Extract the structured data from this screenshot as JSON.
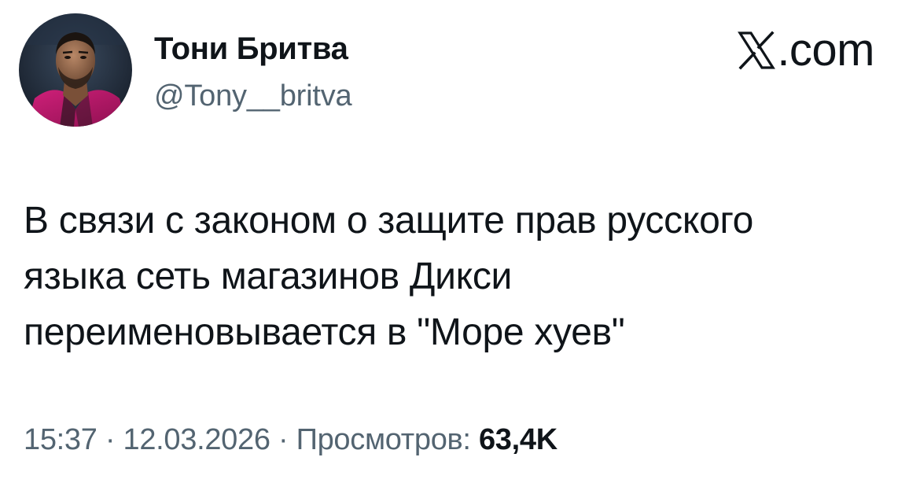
{
  "user": {
    "display_name": "Тони Бритва",
    "handle": "@Tony__britva",
    "avatar_icon": "profile-photo-man-magenta-jacket"
  },
  "brand": {
    "text": ".com",
    "icon": "x-logo-icon"
  },
  "tweet": {
    "text": "В связи с законом о защите прав русского\nязыка сеть магазинов Дикси\nпереименовывается в \"Море хуев\""
  },
  "meta": {
    "time": "15:37",
    "separator": "·",
    "date": "12.03.2026",
    "views_label": "Просмотров:",
    "views_count": "63,4K"
  },
  "colors": {
    "text_primary": "#0f1419",
    "text_secondary": "#536471",
    "background": "#ffffff"
  }
}
